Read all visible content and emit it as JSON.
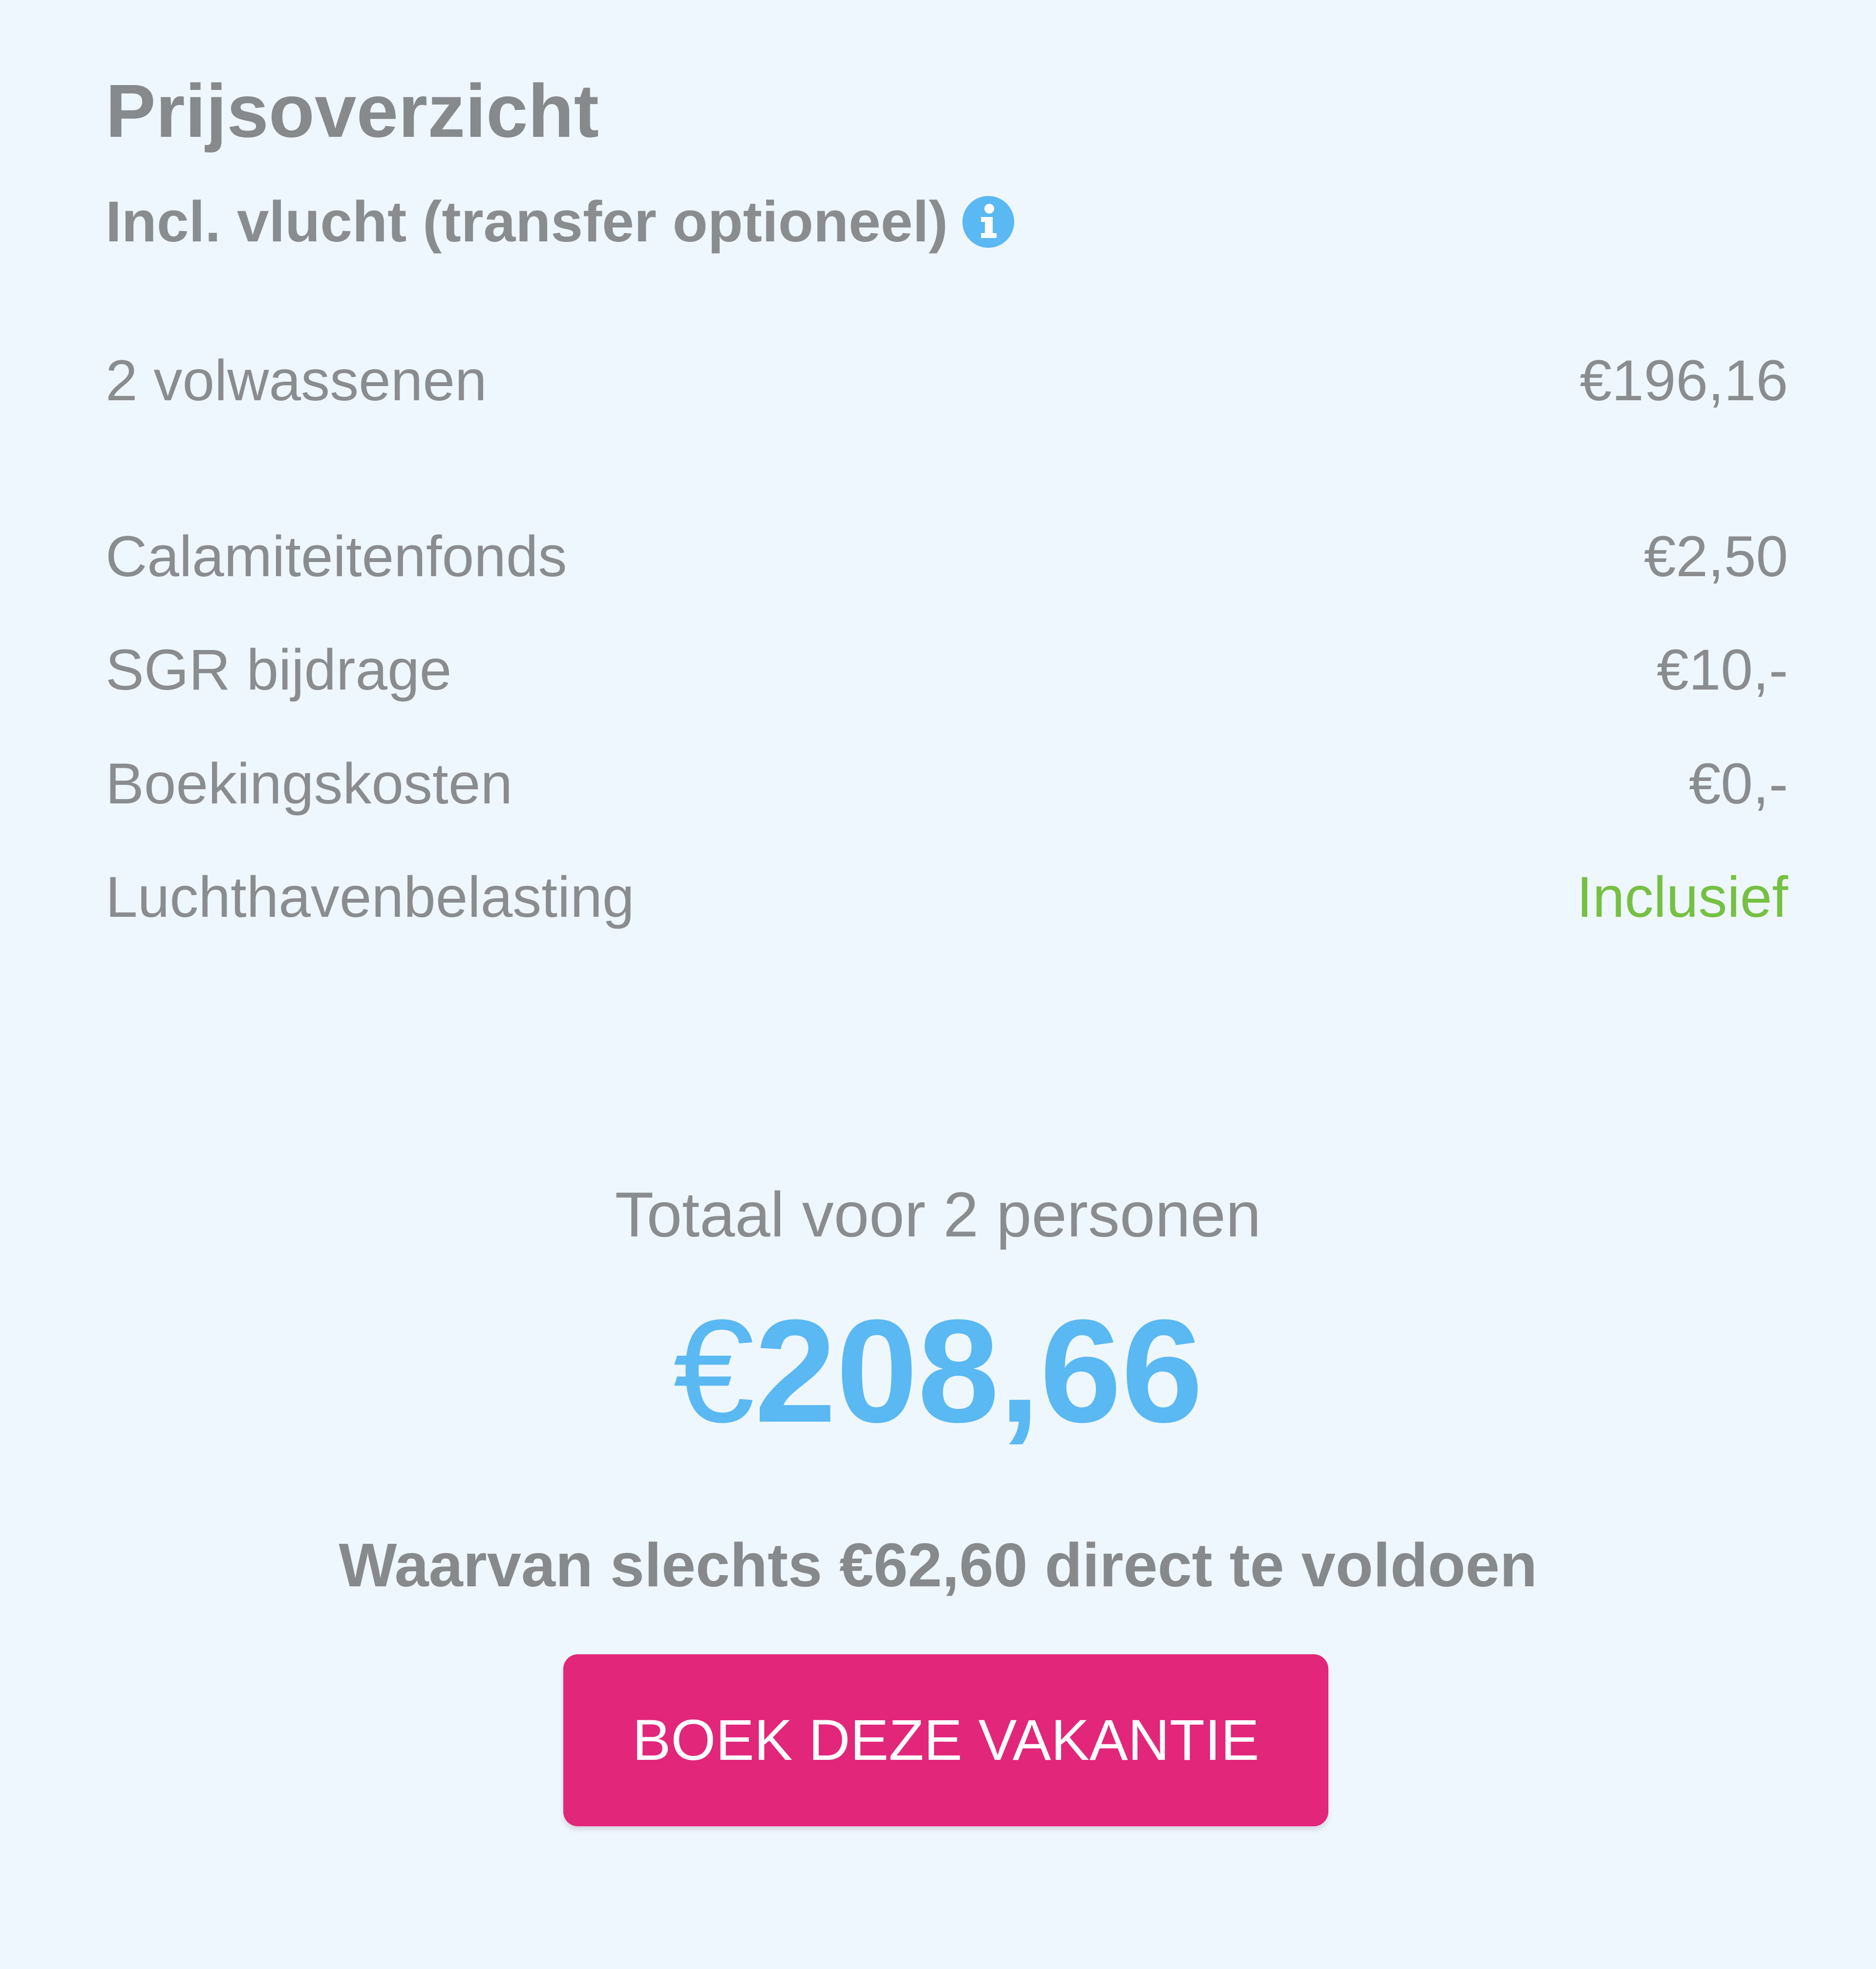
{
  "price_overview": {
    "title": "Prijsoverzicht",
    "subtitle": "Incl. vlucht (transfer optioneel)",
    "subtitle_icon": "info-icon",
    "rows": [
      {
        "label": "2 volwassenen",
        "value": "€196,16"
      },
      {
        "label": "Calamiteitenfonds",
        "value": "€2,50"
      },
      {
        "label": "SGR bijdrage",
        "value": "€10,-"
      },
      {
        "label": "Boekingskosten",
        "value": "€0,-"
      },
      {
        "label": "Luchthavenbelasting",
        "value": "Inclusief"
      }
    ],
    "total_label": "Totaal voor 2 personen",
    "total_currency": "€",
    "total_amount": "208,66",
    "deposit_text": "Waarvan slechts €62,60 direct te voldoen",
    "book_button_label": "BOEK DEZE VAKANTIE"
  },
  "colors": {
    "background": "#eff7fe",
    "text_gray": "#8a8d90",
    "accent_blue": "#5ab8f2",
    "included_green": "#76c043",
    "button_pink": "#e2267a"
  }
}
